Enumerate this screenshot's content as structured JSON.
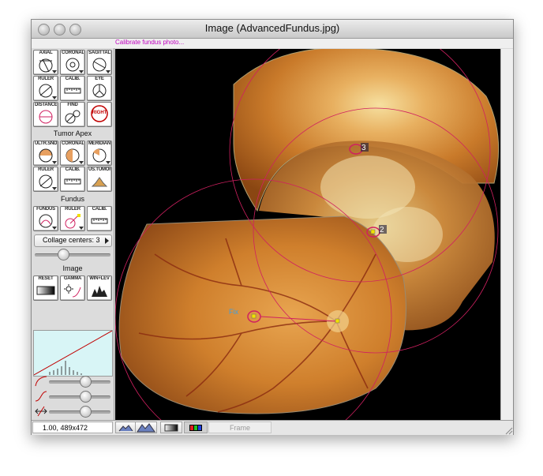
{
  "window": {
    "title": "Image (AdvancedFundus.jpg)",
    "subtitle": "Calibrate fundus photo..."
  },
  "toolbar_top": [
    {
      "label": "AXIAL",
      "icon": "axial-eye-icon"
    },
    {
      "label": "CORONAL",
      "icon": "coronal-eye-icon"
    },
    {
      "label": "SAGITTAL",
      "icon": "sagittal-eye-icon"
    },
    {
      "label": "RULER",
      "icon": "ruler-circle-icon"
    },
    {
      "label": "CALIB.",
      "icon": "calibration-scale-icon"
    },
    {
      "label": "EYE",
      "icon": "eye-icon"
    },
    {
      "label": "DISTANCE",
      "icon": "distance-icon"
    },
    {
      "label": "FIND",
      "icon": "find-icon"
    },
    {
      "label": "",
      "icon": "right-eye-icon",
      "text": "RIGHT"
    }
  ],
  "sections": {
    "tumor_apex": "Tumor Apex",
    "fundus": "Fundus",
    "image": "Image"
  },
  "toolbar_tumor": [
    {
      "label": "ULTR.SND",
      "icon": "ultrasound-icon"
    },
    {
      "label": "CORONAL",
      "icon": "coronal-half-icon"
    },
    {
      "label": "MERIDIAN",
      "icon": "meridian-icon"
    },
    {
      "label": "RULER",
      "icon": "ruler-circle-icon"
    },
    {
      "label": "CALIB.",
      "icon": "calibration-scale-icon"
    },
    {
      "label": "US.TUMOR",
      "icon": "us-tumor-icon"
    }
  ],
  "toolbar_fundus": [
    {
      "label": "FUNDUS",
      "icon": "fundus-icon"
    },
    {
      "label": "RULER",
      "icon": "fundus-ruler-icon"
    },
    {
      "label": "CALIB.",
      "icon": "calibration-scale-icon"
    }
  ],
  "collage_popup": "Collage centers: 3",
  "collage_slider_value": 0.35,
  "toolbar_image": [
    {
      "label": "RESET",
      "icon": "reset-gradient-icon"
    },
    {
      "label": "GAMMA",
      "icon": "gamma-icon"
    },
    {
      "label": "WIN+LEV",
      "icon": "window-level-icon"
    }
  ],
  "adjust_sliders": [
    {
      "icon": "gamma-curve-icon",
      "value": 0.6
    },
    {
      "icon": "contrast-curve-icon",
      "value": 0.6
    },
    {
      "icon": "shift-curve-icon",
      "value": 0.6
    }
  ],
  "overlay_labels": {
    "marker_3": "3",
    "marker_2": "2",
    "marker_1": "Fix"
  },
  "status": {
    "readout": "1.00, 489x472",
    "frame_label": "Frame"
  },
  "colors": {
    "accent_magenta": "#c000c0",
    "overlay_circle": "#d02060",
    "marker_yellow": "#f0e000",
    "histogram_bg": "#d8f5f6"
  }
}
